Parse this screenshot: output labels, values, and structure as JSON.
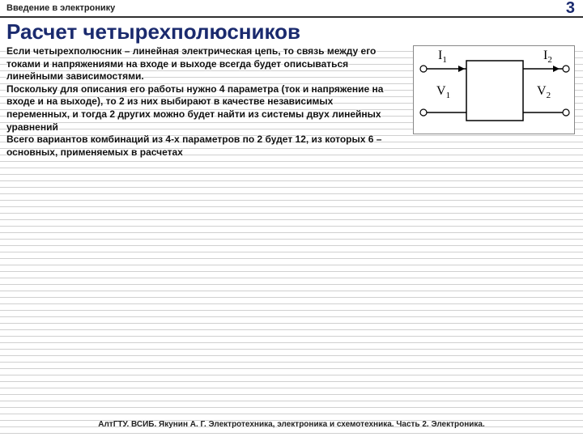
{
  "header": {
    "topic": "Введение в электронику",
    "page_number": "3"
  },
  "title": "Расчет четырехполюсников",
  "paragraphs": [
    "Если четырехполюсник – линейная электрическая цепь, то связь между его токами и напряжениями на входе и выходе всегда будет описываться линейными зависимостями.",
    "Поскольку для описания его работы нужно 4 параметра (ток и напряжение на входе и на выходе), то 2 из них выбирают в качестве независимых переменных, и тогда 2 других можно будет найти из системы двух линейных уравнений",
    "Всего вариантов комбинаций из 4-х параметров по 2 будет 12, из которых 6 – основных, применяемых в расчетах"
  ],
  "diagram": {
    "labels": {
      "I1": "I",
      "I1_sub": "1",
      "I2": "I",
      "I2_sub": "2",
      "V1": "V",
      "V1_sub": "1",
      "V2": "V",
      "V2_sub": "2"
    }
  },
  "footer": "АлтГТУ. ВСИБ. Якунин А. Г. Электротехника, электроника и схемотехника. Часть 2. Электроника."
}
